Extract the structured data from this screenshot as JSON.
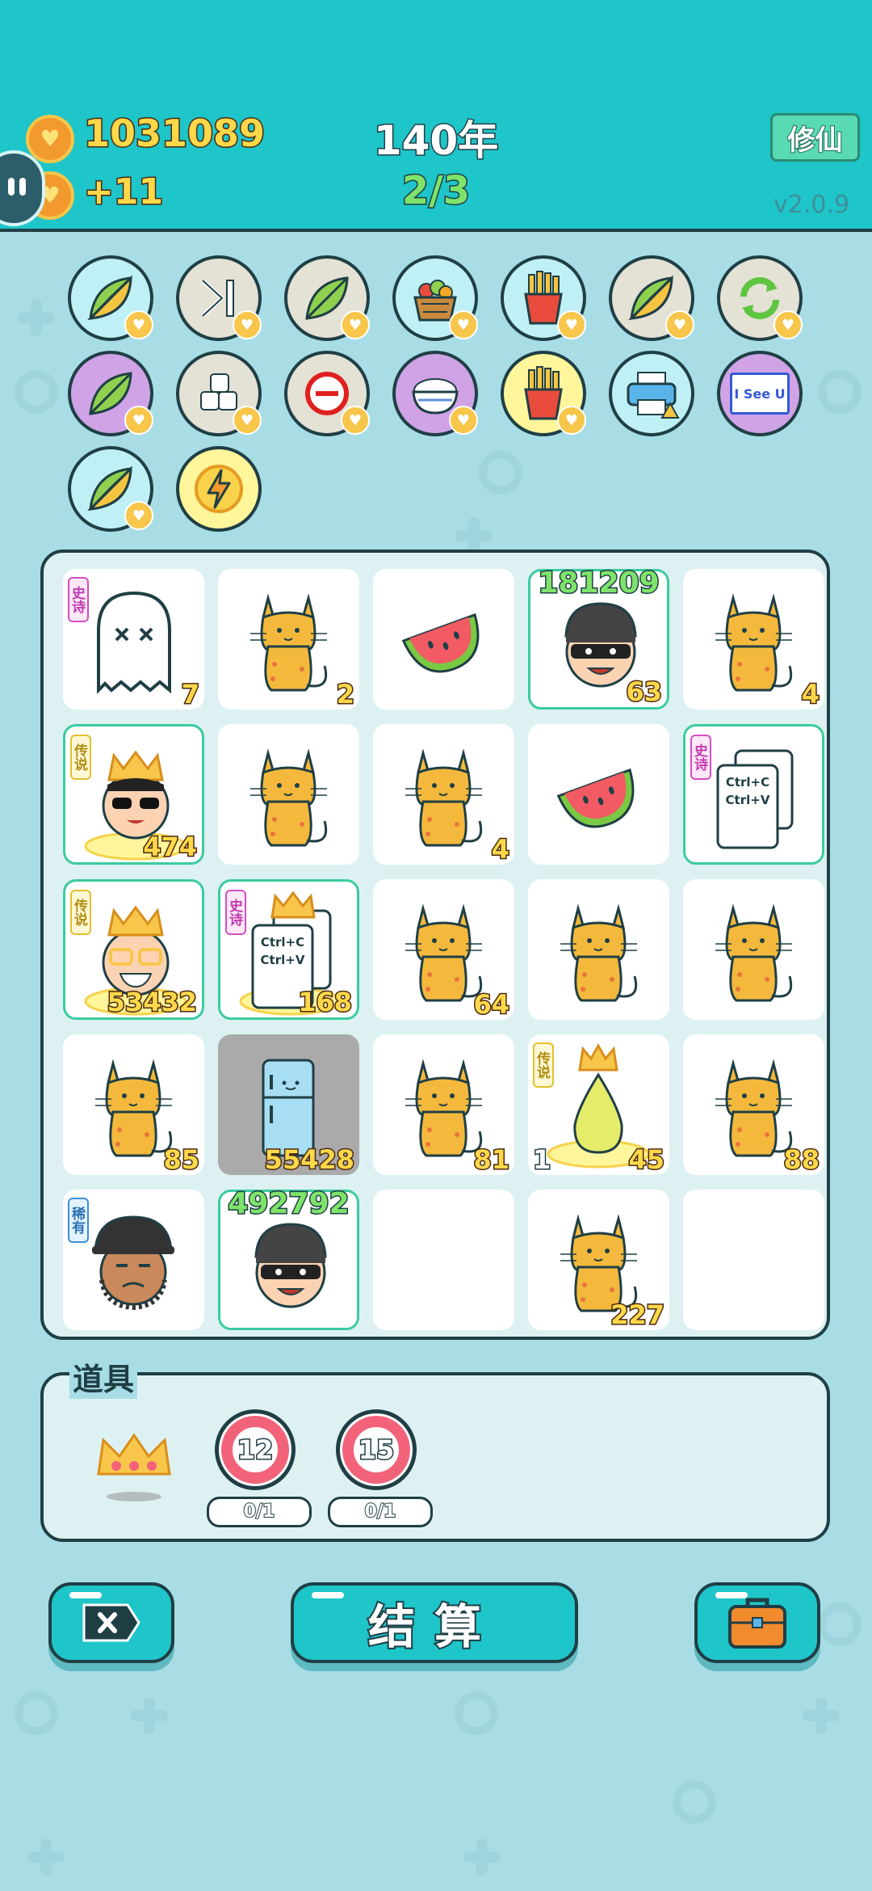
{
  "header": {
    "coins": "1031089",
    "income": "+11",
    "year": "140年",
    "progress": "2/3",
    "xiuxian_label": "修仙",
    "version": "v2.0.9"
  },
  "skills": [
    {
      "icon": "leaf-icon",
      "bg": "#bff0f5"
    },
    {
      "icon": "skip-icon",
      "bg": "#e4e1d5"
    },
    {
      "icon": "leaf-icon",
      "bg": "#e4e1d5"
    },
    {
      "icon": "fruit-basket-icon",
      "bg": "#bff0f5"
    },
    {
      "icon": "fries-icon",
      "bg": "#bff0f5"
    },
    {
      "icon": "leaf-icon",
      "bg": "#e4e1d5"
    },
    {
      "icon": "refresh-icon",
      "bg": "#e4e1d5"
    },
    {
      "icon": "leaf-icon",
      "bg": "#cfa3e6"
    },
    {
      "icon": "sugar-cubes-icon",
      "bg": "#e4e1d5"
    },
    {
      "icon": "minus-icon",
      "bg": "#e4e1d5"
    },
    {
      "icon": "rice-bowl-icon",
      "bg": "#cfa3e6"
    },
    {
      "icon": "fries-icon",
      "bg": "#fff59a"
    },
    {
      "icon": "printer-icon",
      "bg": "#bff0f5"
    },
    {
      "icon": "i-see-u-icon",
      "bg": "#cfa3e6",
      "label": "I See U"
    },
    {
      "icon": "leaf-icon",
      "bg": "#bff0f5"
    },
    {
      "icon": "lightning-icon",
      "bg": "#fff59a"
    }
  ],
  "cells": [
    {
      "art": "ghost",
      "tag": "史诗",
      "num": "7"
    },
    {
      "art": "cat",
      "num": "2"
    },
    {
      "art": "watermelon"
    },
    {
      "art": "thief",
      "top": "181209",
      "num": "63",
      "hl": true
    },
    {
      "art": "cat",
      "num": "4"
    },
    {
      "art": "king-sunglasses",
      "tag": "传说",
      "num": "474",
      "hl": true
    },
    {
      "art": "cat"
    },
    {
      "art": "cat",
      "num": "4"
    },
    {
      "art": "watermelon"
    },
    {
      "art": "ctrl",
      "tag": "史诗",
      "hl": true,
      "line1": "Ctrl+C",
      "line2": "Ctrl+V"
    },
    {
      "art": "king-grin",
      "tag": "传说",
      "num": "53432",
      "hl": true
    },
    {
      "art": "ctrl-crown",
      "tag": "史诗",
      "num": "168",
      "hl": true,
      "line1": "Ctrl+C",
      "line2": "Ctrl+V"
    },
    {
      "art": "cat",
      "num": "64"
    },
    {
      "art": "cat"
    },
    {
      "art": "cat"
    },
    {
      "art": "cat",
      "num": "85"
    },
    {
      "art": "fridge",
      "num": "55428",
      "gray": true
    },
    {
      "art": "cat",
      "num": "81"
    },
    {
      "art": "pear-crown",
      "tag": "传说",
      "lnum": "1",
      "num": "45"
    },
    {
      "art": "cat",
      "num": "88"
    },
    {
      "art": "bucket-hat-man",
      "tag": "稀有"
    },
    {
      "art": "thief",
      "top": "492792",
      "hl": true
    },
    {
      "art": "empty"
    },
    {
      "art": "cat",
      "num": "227"
    },
    {
      "art": "empty"
    }
  ],
  "props": {
    "label": "道具",
    "items": [
      {
        "icon": "crown-icon"
      },
      {
        "icon": "target-icon",
        "value": "12",
        "count": "0/1"
      },
      {
        "icon": "target-icon",
        "value": "15",
        "count": "0/1"
      }
    ]
  },
  "buttons": {
    "settle_label": "结算"
  },
  "colors": {
    "header_bg": "#1ec5c9",
    "page_bg": "#a8dde6",
    "highlight": "#3bcba0",
    "coin_text": "#ffd84a",
    "progress_text": "#7ee36a"
  }
}
